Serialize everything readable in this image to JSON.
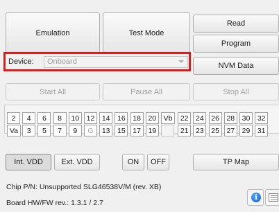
{
  "toolbar": {
    "emulation": "Emulation",
    "test_mode": "Test Mode",
    "read": "Read",
    "program": "Program"
  },
  "device": {
    "label": "Device:",
    "selected": "Onboard"
  },
  "nvm_data": "NVM Data",
  "run_controls": {
    "start_all": "Start All",
    "pause_all": "Pause All",
    "stop_all": "Stop All"
  },
  "pins": {
    "top_row": [
      "2",
      "4",
      "6",
      "8",
      "10",
      "12",
      "14",
      "16",
      "18",
      "20",
      "Vb",
      "22",
      "24",
      "26",
      "28",
      "30",
      "32"
    ],
    "bottom_row": [
      "Va",
      "3",
      "5",
      "7",
      "9",
      "G",
      "13",
      "15",
      "17",
      "19",
      "",
      "21",
      "23",
      "25",
      "27",
      "29",
      "31"
    ]
  },
  "power": {
    "int_vdd": "Int. VDD",
    "ext_vdd": "Ext. VDD",
    "on": "ON",
    "off": "OFF",
    "tp_map": "TP Map"
  },
  "info": {
    "chip": "Chip P/N: Unsupported SLG46538V/M (rev. XB)",
    "board": "Board HW/FW rev.: 1.3.1 / 2.7"
  },
  "colors": {
    "highlight": "#e01b1b",
    "info_icon": "#0d5fc8"
  }
}
